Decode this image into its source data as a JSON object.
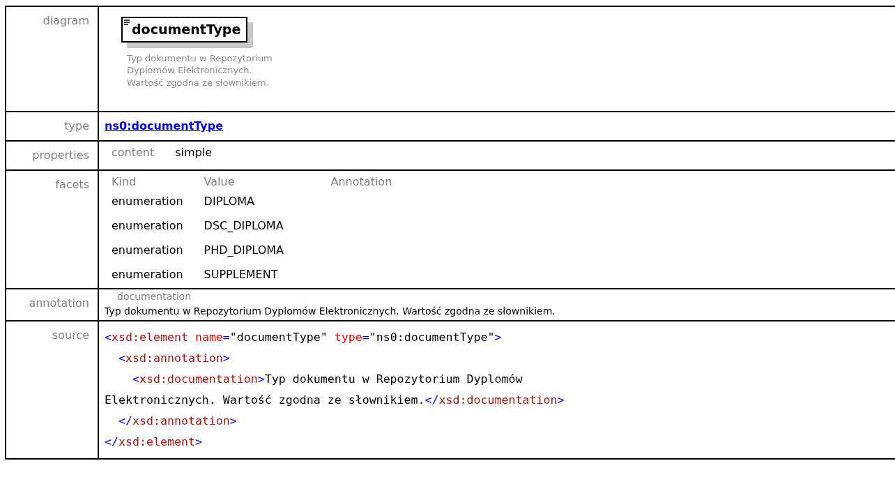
{
  "sections": [
    {
      "kind": "diagram",
      "label": "diagram",
      "element_name": "documentType",
      "description": "Typ dokumentu w Repozytorium Dyplomów Elektronicznych. Wartość zgodna ze słownikiem."
    },
    {
      "kind": "type",
      "label": "type",
      "link": "ns0:documentType"
    },
    {
      "kind": "properties",
      "label": "properties",
      "items": [
        {
          "name": "content",
          "value": "simple"
        }
      ]
    },
    {
      "kind": "facets",
      "label": "facets",
      "columns": [
        "Kind",
        "Value",
        "Annotation"
      ],
      "rows": [
        {
          "kind": "enumeration",
          "value": "DIPLOMA"
        },
        {
          "kind": "enumeration",
          "value": "DSC_DIPLOMA"
        },
        {
          "kind": "enumeration",
          "value": "PHD_DIPLOMA"
        },
        {
          "kind": "enumeration",
          "value": "SUPPLEMENT"
        }
      ]
    },
    {
      "kind": "annotation",
      "label": "annotation",
      "heading": "documentation",
      "text": "Typ dokumentu w Repozytorium Dyplomów Elektronicznych. Wartość zgodna ze słownikiem."
    },
    {
      "kind": "source",
      "label": "source",
      "lines": [
        [
          {
            "kind": "bracket",
            "text": "<"
          },
          {
            "kind": "tag",
            "text": "xsd:element"
          },
          {
            "kind": "attribute",
            "text": " name"
          },
          {
            "kind": "bracket",
            "text": "="
          },
          {
            "kind": "text",
            "text": "\"documentType\""
          },
          {
            "kind": "attribute",
            "text": " type"
          },
          {
            "kind": "bracket",
            "text": "="
          },
          {
            "kind": "text",
            "text": "\"ns0:documentType\""
          },
          {
            "kind": "bracket",
            "text": ">"
          }
        ],
        [
          {
            "kind": "bracket",
            "text": "  <"
          },
          {
            "kind": "tag",
            "text": "xsd:annotation"
          },
          {
            "kind": "bracket",
            "text": ">"
          }
        ],
        [
          {
            "kind": "bracket",
            "text": "    <"
          },
          {
            "kind": "tag",
            "text": "xsd:documentation"
          },
          {
            "kind": "bracket",
            "text": ">"
          },
          {
            "kind": "text",
            "text": "Typ dokumentu w Repozytorium Dyplomów"
          }
        ],
        [
          {
            "kind": "text",
            "text": "Elektronicznych. Wartość zgodna ze słownikiem."
          },
          {
            "kind": "bracket",
            "text": "</"
          },
          {
            "kind": "tag",
            "text": "xsd:documentation"
          },
          {
            "kind": "bracket",
            "text": ">"
          }
        ],
        [
          {
            "kind": "bracket",
            "text": "  </"
          },
          {
            "kind": "tag",
            "text": "xsd:annotation"
          },
          {
            "kind": "bracket",
            "text": ">"
          }
        ],
        [
          {
            "kind": "bracket",
            "text": "</"
          },
          {
            "kind": "tag",
            "text": "xsd:element"
          },
          {
            "kind": "bracket",
            "text": ">"
          }
        ]
      ]
    }
  ]
}
